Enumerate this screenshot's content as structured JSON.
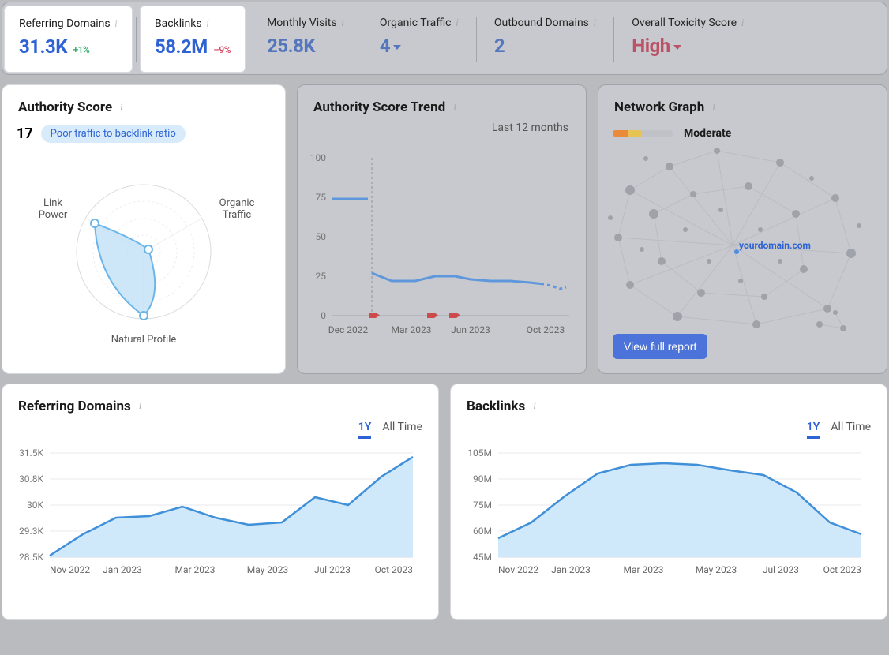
{
  "top_stats": {
    "ref_domains": {
      "label": "Referring Domains",
      "value": "31.3K",
      "change": "+1%"
    },
    "backlinks": {
      "label": "Backlinks",
      "value": "58.2M",
      "change": "–9%"
    },
    "monthly_visits": {
      "label": "Monthly Visits",
      "value": "25.8K"
    },
    "organic_traffic": {
      "label": "Organic Traffic",
      "value": "4"
    },
    "outbound": {
      "label": "Outbound Domains",
      "value": "2"
    },
    "toxicity": {
      "label": "Overall Toxicity Score",
      "value": "High"
    }
  },
  "authority_score": {
    "title": "Authority Score",
    "value": "17",
    "badge": "Poor traffic to backlink ratio",
    "radar_labels": {
      "link_power": "Link\nPower",
      "organic": "Organic\nTraffic",
      "natural": "Natural Profile"
    }
  },
  "trend": {
    "title": "Authority Score Trend",
    "range_label": "Last 12 months",
    "y_ticks": [
      "100",
      "75",
      "50",
      "25",
      "0"
    ],
    "x_ticks": [
      "Dec 2022",
      "Mar 2023",
      "Jun 2023",
      "Oct 2023"
    ]
  },
  "network": {
    "title": "Network Graph",
    "quality": "Moderate",
    "node_label": "yourdomain.com",
    "button": "View full report"
  },
  "ref_domains_chart": {
    "title": "Referring Domains",
    "tabs": {
      "y1": "1Y",
      "all": "All Time"
    },
    "y_ticks": [
      "31.5K",
      "30.8K",
      "30K",
      "29.3K",
      "28.5K"
    ],
    "x_ticks": [
      "Nov 2022",
      "Jan 2023",
      "Mar 2023",
      "May 2023",
      "Jul 2023",
      "Oct 2023"
    ]
  },
  "backlinks_chart": {
    "title": "Backlinks",
    "tabs": {
      "y1": "1Y",
      "all": "All Time"
    },
    "y_ticks": [
      "105M",
      "90M",
      "75M",
      "60M",
      "45M"
    ],
    "x_ticks": [
      "Nov 2022",
      "Jan 2023",
      "Mar 2023",
      "May 2023",
      "Jul 2023",
      "Oct 2023"
    ]
  },
  "chart_data": [
    {
      "type": "radar",
      "title": "Authority Score",
      "axes": [
        "Link Power",
        "Organic Traffic",
        "Natural Profile"
      ],
      "values": [
        85,
        8,
        95
      ],
      "max": 100
    },
    {
      "type": "line",
      "title": "Authority Score Trend",
      "xlabel": "",
      "ylabel": "",
      "ylim": [
        0,
        100
      ],
      "x": [
        "Nov 2022",
        "Dec 2022",
        "Jan 2023",
        "Feb 2023",
        "Mar 2023",
        "Apr 2023",
        "May 2023",
        "Jun 2023",
        "Jul 2023",
        "Aug 2023",
        "Sep 2023",
        "Oct 2023"
      ],
      "series": [
        {
          "name": "Authority",
          "values": [
            74,
            74,
            27,
            22,
            22,
            25,
            25,
            23,
            22,
            22,
            21,
            19
          ]
        }
      ],
      "markers_x": [
        "Jan 2023",
        "Apr 2023",
        "May 2023"
      ]
    },
    {
      "type": "area",
      "title": "Referring Domains",
      "ylim": [
        28500,
        31500
      ],
      "x": [
        "Nov 2022",
        "Dec 2022",
        "Jan 2023",
        "Feb 2023",
        "Mar 2023",
        "Apr 2023",
        "May 2023",
        "Jun 2023",
        "Jul 2023",
        "Aug 2023",
        "Sep 2023",
        "Oct 2023"
      ],
      "series": [
        {
          "name": "Referring Domains",
          "values": [
            28550,
            29100,
            29600,
            29650,
            29900,
            29600,
            29400,
            29450,
            30200,
            29950,
            30700,
            31400
          ]
        }
      ]
    },
    {
      "type": "area",
      "title": "Backlinks",
      "ylim": [
        45000000,
        105000000
      ],
      "x": [
        "Nov 2022",
        "Dec 2022",
        "Jan 2023",
        "Feb 2023",
        "Mar 2023",
        "Apr 2023",
        "May 2023",
        "Jun 2023",
        "Jul 2023",
        "Aug 2023",
        "Sep 2023",
        "Oct 2023"
      ],
      "series": [
        {
          "name": "Backlinks",
          "values": [
            56000000,
            65000000,
            80000000,
            93000000,
            98000000,
            99000000,
            98000000,
            95000000,
            92000000,
            82000000,
            65000000,
            58000000
          ]
        }
      ]
    }
  ]
}
